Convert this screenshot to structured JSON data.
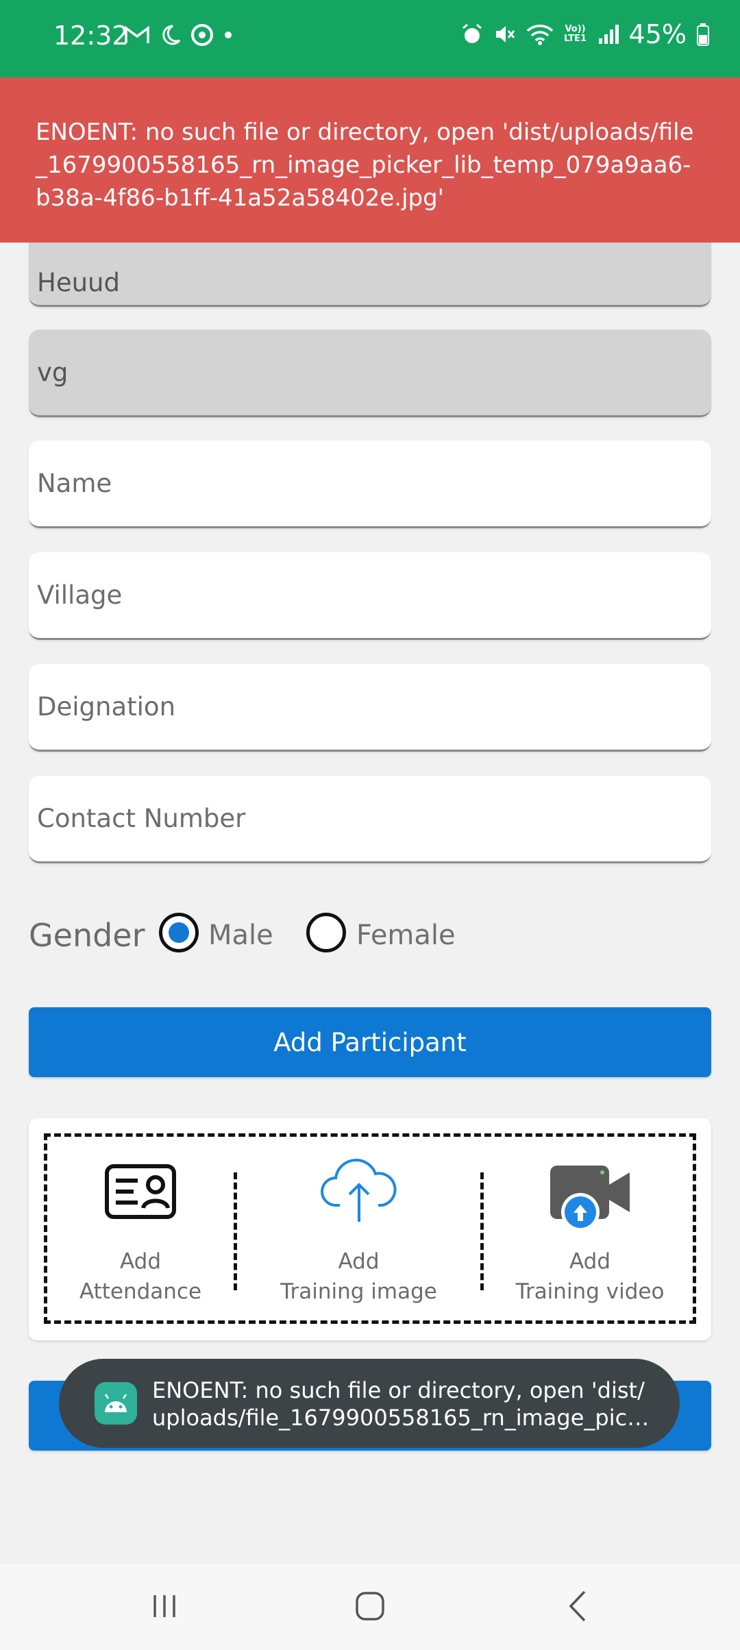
{
  "status_bar": {
    "time": "12:32",
    "battery": "45%",
    "left_icons": [
      "gmail-icon",
      "do-not-disturb-moon-icon",
      "chrome-icon",
      "dot-icon"
    ],
    "right_icons": [
      "alarm-icon",
      "mute-icon",
      "wifi-icon",
      "volte-icon",
      "signal-icon",
      "battery-icon"
    ],
    "volte_text": "Vo)) LTE1"
  },
  "error_banner": {
    "message": "ENOENT: no such file or directory, open 'dist/uploads/file_1679900558165_rn_image_picker_lib_temp_079a9aa6-b38a-4f86-b1ff-41a52a58402e.jpg'"
  },
  "form": {
    "field1_value": "Heuud",
    "field2_value": "vg",
    "name_placeholder": "Name",
    "village_placeholder": "Village",
    "designation_placeholder": "Deignation",
    "contact_placeholder": "Contact Number",
    "gender_label": "Gender",
    "gender_options": [
      "Male",
      "Female"
    ],
    "gender_selected": "Male",
    "add_participant_label": "Add Participant"
  },
  "uploads": {
    "attendance_label_line1": "Add",
    "attendance_label_line2": "Attendance",
    "image_label_line1": "Add",
    "image_label_line2": "Training image",
    "video_label_line1": "Add",
    "video_label_line2": "Training video",
    "accent_color": "#1e88e5"
  },
  "toast": {
    "line1": "ENOENT: no such file or directory, open 'dist/",
    "line2": "uploads/file_1679900558165_rn_image_pick..."
  },
  "colors": {
    "status_bar": "#14a661",
    "error_banner": "#d9534f",
    "primary": "#0f78d2",
    "toast_bg": "#3d4448"
  }
}
